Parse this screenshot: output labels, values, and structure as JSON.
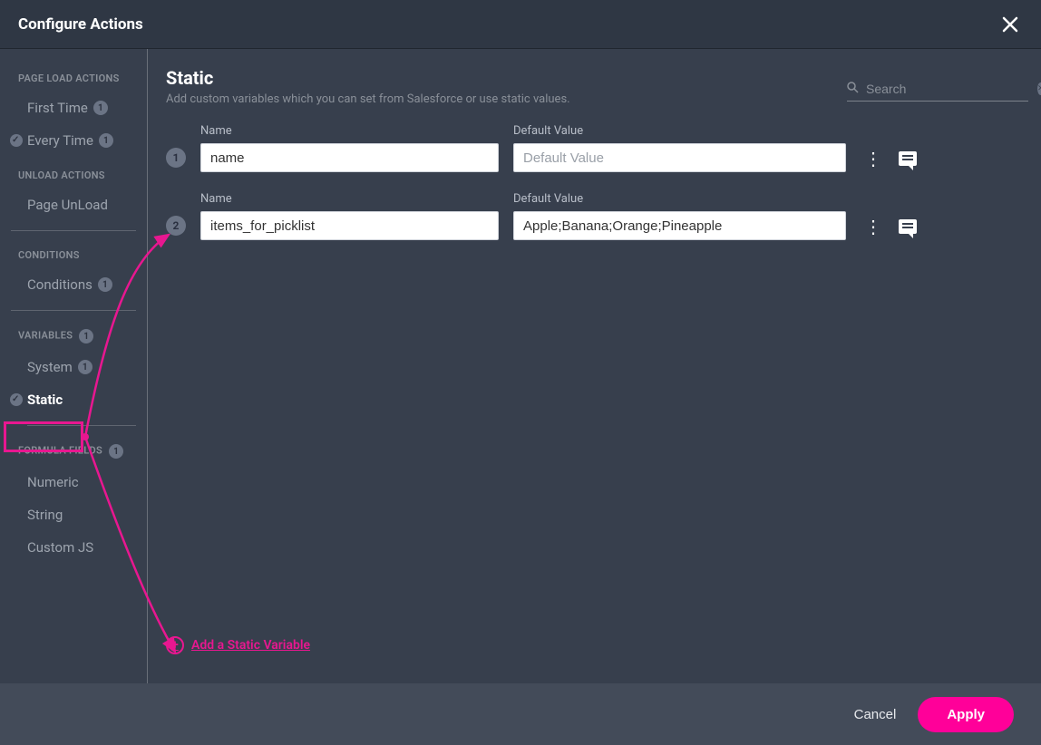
{
  "modal": {
    "title": "Configure Actions"
  },
  "sidebar": {
    "sections": [
      {
        "header": "PAGE LOAD ACTIONS"
      },
      {
        "header": "UNLOAD ACTIONS"
      },
      {
        "header": "CONDITIONS"
      },
      {
        "header": "VARIABLES",
        "count": "1"
      },
      {
        "header": "FORMULA FIELDS",
        "count": "1"
      }
    ],
    "items": {
      "first_time": {
        "label": "First Time",
        "count": "1"
      },
      "every_time": {
        "label": "Every Time",
        "count": "1"
      },
      "page_unload": {
        "label": "Page UnLoad"
      },
      "conditions": {
        "label": "Conditions",
        "count": "1"
      },
      "system": {
        "label": "System",
        "count": "1"
      },
      "static": {
        "label": "Static"
      },
      "numeric": {
        "label": "Numeric"
      },
      "string": {
        "label": "String"
      },
      "custom_js": {
        "label": "Custom JS"
      }
    }
  },
  "content": {
    "title": "Static",
    "description": "Add custom variables which you can set from Salesforce or use static values.",
    "search_placeholder": "Search",
    "labels": {
      "name": "Name",
      "default_value": "Default Value"
    },
    "placeholders": {
      "default_value": "Default Value"
    },
    "rows": [
      {
        "num": "1",
        "name": "name",
        "value": ""
      },
      {
        "num": "2",
        "name": "items_for_picklist",
        "value": "Apple;Banana;Orange;Pineapple"
      }
    ],
    "add_link": "Add a Static Variable"
  },
  "footer": {
    "cancel": "Cancel",
    "apply": "Apply"
  }
}
